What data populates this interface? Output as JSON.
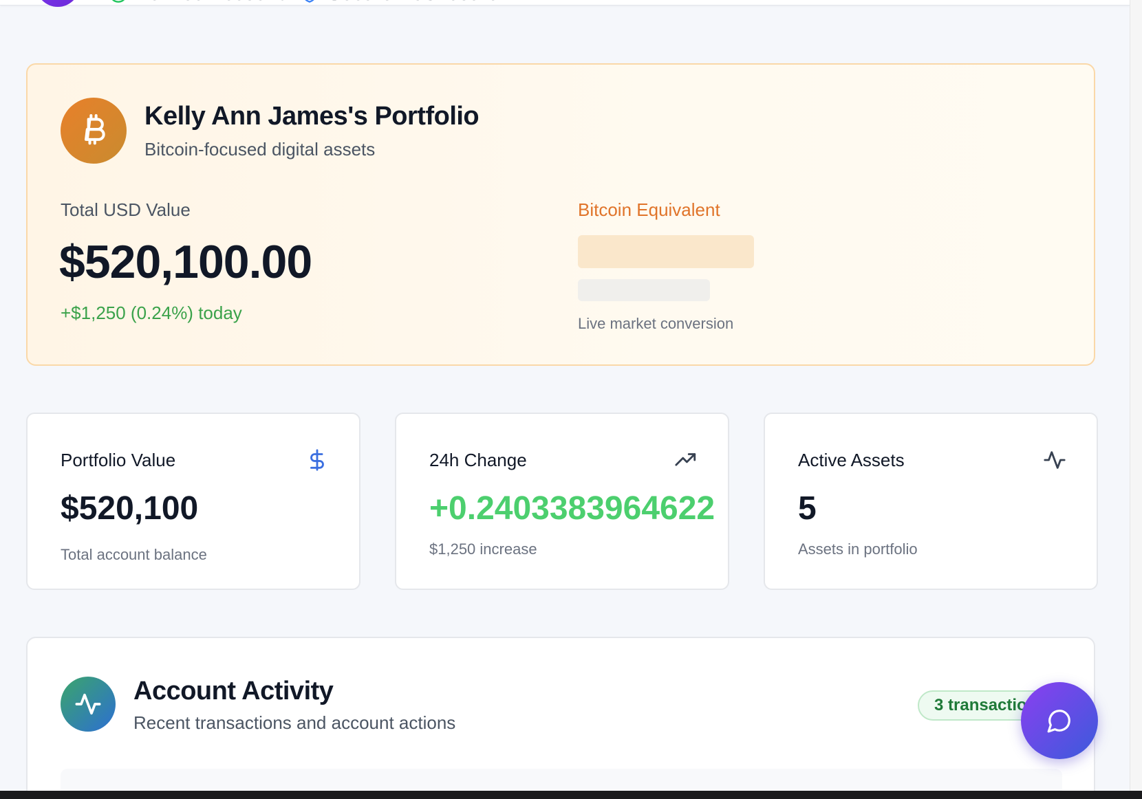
{
  "header": {
    "badges": [
      {
        "label": "Verified Account",
        "icon": "check-circle-icon",
        "color": "#22c55e"
      },
      {
        "label": "Secure Dashboard",
        "icon": "shield-icon",
        "color": "#3b82f6"
      }
    ]
  },
  "portfolio": {
    "icon": "bitcoin-icon",
    "title": "Kelly Ann James's Portfolio",
    "subtitle": "Bitcoin-focused digital assets",
    "usd_label": "Total USD Value",
    "usd_value": "$520,100.00",
    "usd_change": "+$1,250 (0.24%) today",
    "btc_label": "Bitcoin Equivalent",
    "btc_caption": "Live market conversion"
  },
  "stats": [
    {
      "title": "Portfolio Value",
      "icon": "dollar-icon",
      "value": "$520,100",
      "sub": "Total account balance"
    },
    {
      "title": "24h Change",
      "icon": "trending-up-icon",
      "value": "+0.2403383964622",
      "sub": "$1,250 increase"
    },
    {
      "title": "Active Assets",
      "icon": "activity-icon",
      "value": "5",
      "sub": "Assets in portfolio"
    }
  ],
  "activity": {
    "icon": "activity-icon",
    "title": "Account Activity",
    "subtitle": "Recent transactions and account actions",
    "badge": "3 transactions"
  },
  "chat": {
    "icon": "chat-bubble-icon"
  },
  "colors": {
    "accent_orange": "#e0742a",
    "positive_green": "#3aa24a",
    "fab_gradient": [
      "#8b3ff0",
      "#3b5bdb"
    ]
  }
}
